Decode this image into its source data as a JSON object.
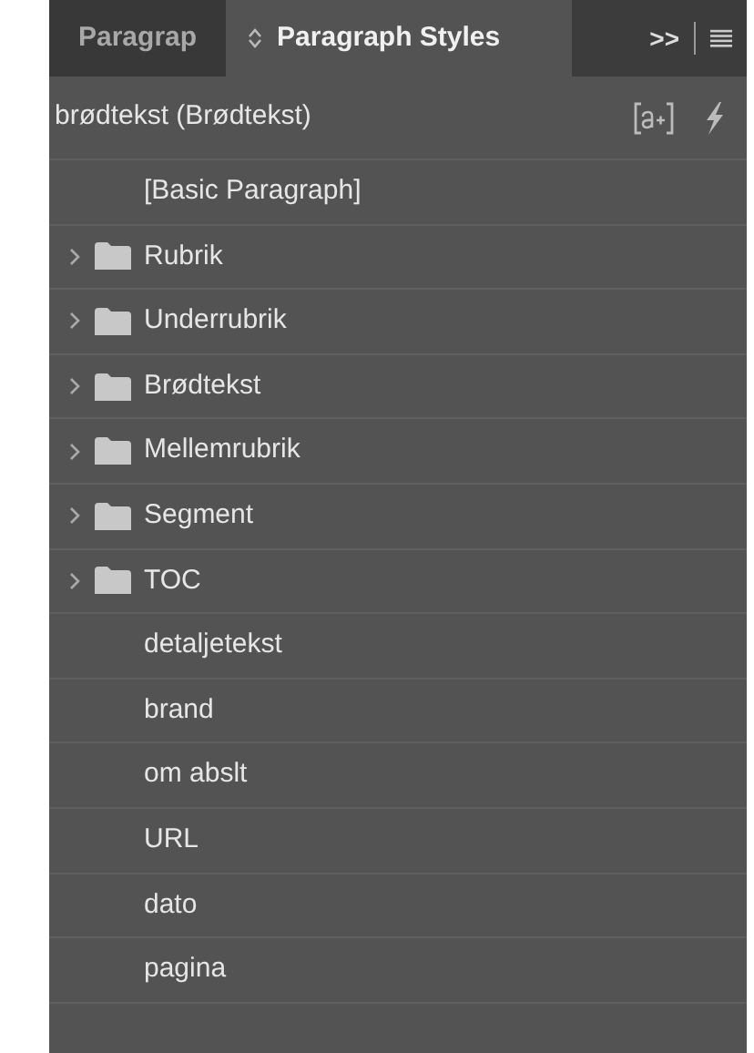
{
  "tabs": [
    {
      "label": "Paragrap",
      "selected": false
    },
    {
      "label": "Paragraph Styles",
      "selected": true
    }
  ],
  "tab_overflow": ">>",
  "current_style": "brødtekst (Brødtekst)",
  "styles": [
    {
      "kind": "style",
      "label": "[Basic Paragraph]"
    },
    {
      "kind": "group",
      "label": "Rubrik",
      "expanded": false
    },
    {
      "kind": "group",
      "label": "Underrubrik",
      "expanded": false
    },
    {
      "kind": "group",
      "label": "Brødtekst",
      "expanded": false
    },
    {
      "kind": "group",
      "label": "Mellemrubrik",
      "expanded": false
    },
    {
      "kind": "group",
      "label": "Segment",
      "expanded": false
    },
    {
      "kind": "group",
      "label": "TOC",
      "expanded": false
    },
    {
      "kind": "style",
      "label": "detaljetekst"
    },
    {
      "kind": "style",
      "label": "brand"
    },
    {
      "kind": "style",
      "label": "om abslt"
    },
    {
      "kind": "style",
      "label": "URL"
    },
    {
      "kind": "style",
      "label": "dato"
    },
    {
      "kind": "style",
      "label": "pagina"
    }
  ]
}
